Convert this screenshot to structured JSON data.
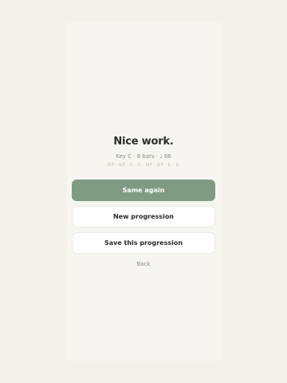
{
  "summary": {
    "title": "Nice work.",
    "meta": "Key C · 8 bars · ♩ 66",
    "chords": "D7 · G7 · C · C · D7 · G7 · C · C"
  },
  "actions": {
    "same_again": "Same again",
    "new_progression": "New progression",
    "save_progression": "Save this progression",
    "back": "Back"
  },
  "colors": {
    "page_background": "#f4f1ea",
    "card_background": "#f7f5f1",
    "primary_button": "#7f9b84",
    "secondary_button": "#ffffff"
  }
}
